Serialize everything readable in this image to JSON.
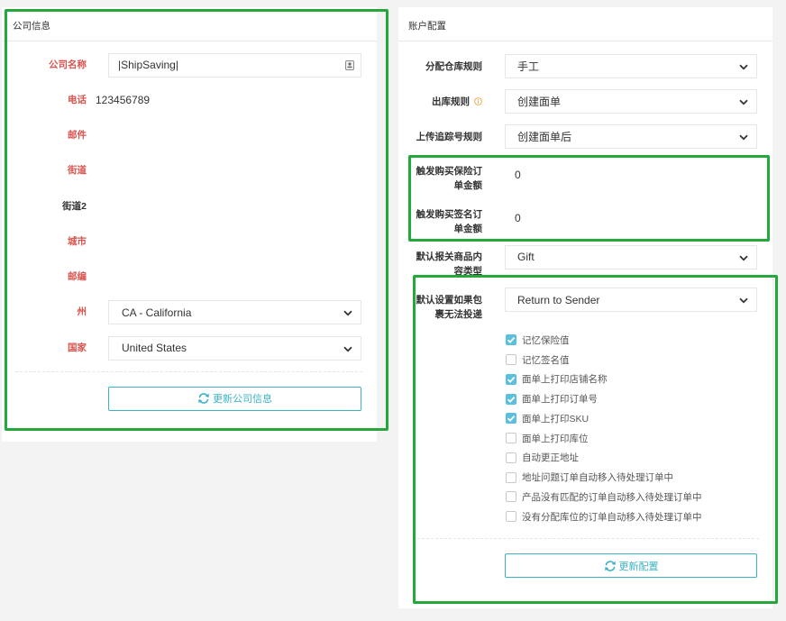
{
  "colors": {
    "page_bg": "#f3f3f4",
    "required_label": "#d9534f",
    "accent": "#3ab3c4",
    "checkbox_checked": "#5bc0de",
    "highlight": "#23a93b",
    "info": "#f0ad4e"
  },
  "icons": {
    "contact": "contact-card-icon",
    "info": "info-icon",
    "dropdown": "chevron-down-icon",
    "refresh": "refresh-icon",
    "check": "check-icon"
  },
  "company": {
    "title": "公司信息",
    "name": {
      "label": "公司名称",
      "required": true,
      "value": "|ShipSaving|"
    },
    "phone": {
      "label": "电话",
      "required": true,
      "value": "123456789"
    },
    "email": {
      "label": "邮件",
      "required": true,
      "value": ""
    },
    "street": {
      "label": "街道",
      "required": true,
      "value": ""
    },
    "street2": {
      "label": "街道2",
      "required": false,
      "value": ""
    },
    "city": {
      "label": "城市",
      "required": true,
      "value": ""
    },
    "zip": {
      "label": "邮编",
      "required": true,
      "value": ""
    },
    "state": {
      "label": "州",
      "required": true,
      "selected": "CA - California"
    },
    "country": {
      "label": "国家",
      "required": true,
      "selected": "United States"
    },
    "update_button": "更新公司信息"
  },
  "account": {
    "title": "账户配置",
    "warehouse_rule": {
      "label": "分配仓库规则",
      "selected": "手工"
    },
    "outbound_rule": {
      "label": "出库规则",
      "selected": "创建面单"
    },
    "tracking_upload_rule": {
      "label": "上传追踪号规则",
      "selected": "创建面单后"
    },
    "insurance_trigger_amount": {
      "label": "触发购买保险订单金额",
      "value": "0"
    },
    "signature_trigger_amount": {
      "label": "触发购买签名订单金额",
      "value": "0"
    },
    "customs_content_type": {
      "label": "默认报关商品内容类型",
      "selected": "Gift"
    },
    "undeliverable_default": {
      "label": "默认设置如果包裹无法投递",
      "selected": "Return to Sender"
    },
    "options": [
      {
        "label": "记忆保险值",
        "checked": true
      },
      {
        "label": "记忆签名值",
        "checked": false
      },
      {
        "label": "面单上打印店铺名称",
        "checked": true
      },
      {
        "label": "面单上打印订单号",
        "checked": true
      },
      {
        "label": "面单上打印SKU",
        "checked": true
      },
      {
        "label": "面单上打印库位",
        "checked": false
      },
      {
        "label": "自动更正地址",
        "checked": false
      },
      {
        "label": "地址问题订单自动移入待处理订单中",
        "checked": false
      },
      {
        "label": "产品没有匹配的订单自动移入待处理订单中",
        "checked": false
      },
      {
        "label": "没有分配库位的订单自动移入待处理订单中",
        "checked": false
      }
    ],
    "update_button": "更新配置"
  }
}
